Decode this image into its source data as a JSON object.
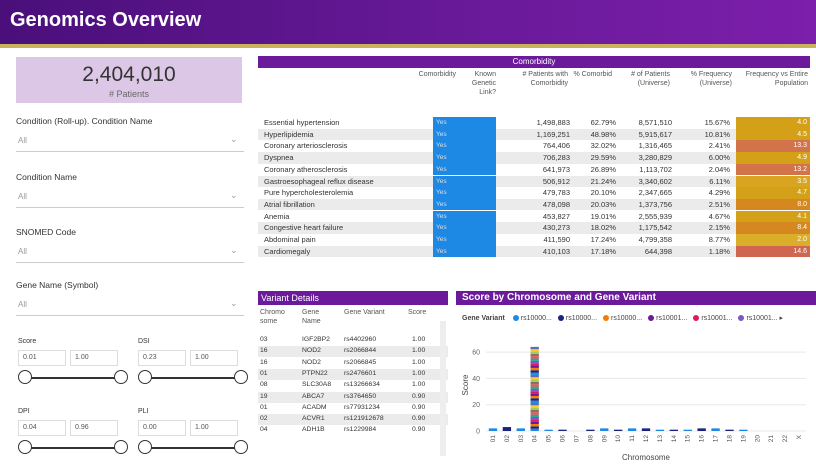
{
  "header": {
    "title": "Genomics Overview"
  },
  "kpi": {
    "value": "2,404,010",
    "label": "# Patients"
  },
  "slicers": [
    {
      "title": "Condition (Roll-up). Condition Name",
      "value": "All"
    },
    {
      "title": "Condition Name",
      "value": "All"
    },
    {
      "title": "SNOMED Code",
      "value": "All"
    },
    {
      "title": "Gene Name (Symbol)",
      "value": "All"
    }
  ],
  "ranges": [
    {
      "title": "Score",
      "min": "0.01",
      "max": "1.00"
    },
    {
      "title": "DSI",
      "min": "0.23",
      "max": "1.00"
    },
    {
      "title": "DPI",
      "min": "0.04",
      "max": "0.96"
    },
    {
      "title": "PLI",
      "min": "0.00",
      "max": "1.00"
    }
  ],
  "comorbidity": {
    "title": "Comorbidity",
    "headers": [
      "Comorbidity",
      "Known Genetic Link?",
      "# Patients with Comorbidity",
      "% Comorbid",
      "# of Patients (Universe)",
      "% Frequency (Universe)",
      "Frequency vs Entire Population"
    ],
    "rows": [
      {
        "name": "Essential hypertension",
        "known": "Yes",
        "patients": "1,498,883",
        "pct": "62.79%",
        "universe": "8,571,510",
        "freq": "15.67%",
        "vs": "4.0",
        "color": "#d4a017"
      },
      {
        "name": "Hyperlipidemia",
        "known": "Yes",
        "patients": "1,169,251",
        "pct": "48.98%",
        "universe": "5,915,617",
        "freq": "10.81%",
        "vs": "4.5",
        "color": "#d4a017"
      },
      {
        "name": "Coronary arteriosclerosis",
        "known": "Yes",
        "patients": "764,406",
        "pct": "32.02%",
        "universe": "1,316,465",
        "freq": "2.41%",
        "vs": "13.3",
        "color": "#d2734a"
      },
      {
        "name": "Dyspnea",
        "known": "Yes",
        "patients": "706,283",
        "pct": "29.59%",
        "universe": "3,280,829",
        "freq": "6.00%",
        "vs": "4.9",
        "color": "#d4a017"
      },
      {
        "name": "Coronary atherosclerosis",
        "known": "Yes",
        "patients": "641,973",
        "pct": "26.89%",
        "universe": "1,113,702",
        "freq": "2.04%",
        "vs": "13.2",
        "color": "#d2734a"
      },
      {
        "name": "Gastroesophageal reflux disease",
        "known": "Yes",
        "patients": "506,912",
        "pct": "21.24%",
        "universe": "3,340,602",
        "freq": "6.11%",
        "vs": "3.5",
        "color": "#d9a521"
      },
      {
        "name": "Pure hypercholesterolemia",
        "known": "Yes",
        "patients": "479,783",
        "pct": "20.10%",
        "universe": "2,347,665",
        "freq": "4.29%",
        "vs": "4.7",
        "color": "#d4a017"
      },
      {
        "name": "Atrial fibrillation",
        "known": "Yes",
        "patients": "478,098",
        "pct": "20.03%",
        "universe": "1,373,756",
        "freq": "2.51%",
        "vs": "8.0",
        "color": "#d4881f"
      },
      {
        "name": "Anemia",
        "known": "Yes",
        "patients": "453,827",
        "pct": "19.01%",
        "universe": "2,555,939",
        "freq": "4.67%",
        "vs": "4.1",
        "color": "#d4a017"
      },
      {
        "name": "Congestive heart failure",
        "known": "Yes",
        "patients": "430,273",
        "pct": "18.02%",
        "universe": "1,175,542",
        "freq": "2.15%",
        "vs": "8.4",
        "color": "#d4881f"
      },
      {
        "name": "Abdominal pain",
        "known": "Yes",
        "patients": "411,590",
        "pct": "17.24%",
        "universe": "4,799,358",
        "freq": "8.77%",
        "vs": "2.0",
        "color": "#dbae2a"
      },
      {
        "name": "Cardiomegaly",
        "known": "Yes",
        "patients": "410,103",
        "pct": "17.18%",
        "universe": "644,398",
        "freq": "1.18%",
        "vs": "14.6",
        "color": "#d0664f"
      }
    ]
  },
  "variant": {
    "title": "Variant Details",
    "headers": [
      "Chromo some",
      "Gene Name",
      "Gene Variant",
      "Score"
    ],
    "rows": [
      {
        "chr": "03",
        "gene": "IGF2BP2",
        "variant": "rs4402960",
        "score": "1.00"
      },
      {
        "chr": "16",
        "gene": "NOD2",
        "variant": "rs2066844",
        "score": "1.00"
      },
      {
        "chr": "16",
        "gene": "NOD2",
        "variant": "rs2066845",
        "score": "1.00"
      },
      {
        "chr": "01",
        "gene": "PTPN22",
        "variant": "rs2476601",
        "score": "1.00"
      },
      {
        "chr": "08",
        "gene": "SLC30A8",
        "variant": "rs13266634",
        "score": "1.00"
      },
      {
        "chr": "19",
        "gene": "ABCA7",
        "variant": "rs3764650",
        "score": "0.90"
      },
      {
        "chr": "01",
        "gene": "ACADM",
        "variant": "rs77931234",
        "score": "0.90"
      },
      {
        "chr": "02",
        "gene": "ACVR1",
        "variant": "rs121912678",
        "score": "0.90"
      },
      {
        "chr": "04",
        "gene": "ADH1B",
        "variant": "rs1229984",
        "score": "0.90"
      }
    ]
  },
  "score_chart": {
    "title": "Score by Chromosome and Gene Variant",
    "legend_label": "Gene Variant",
    "legend": [
      {
        "name": "rs10000...",
        "color": "#1e88e5"
      },
      {
        "name": "rs10000...",
        "color": "#1a237e"
      },
      {
        "name": "rs10000...",
        "color": "#f57c00"
      },
      {
        "name": "rs10001...",
        "color": "#6a1a9a"
      },
      {
        "name": "rs10001...",
        "color": "#d81b60"
      },
      {
        "name": "rs10001...",
        "color": "#7e57c2"
      }
    ],
    "more_icon": "chevron-right-icon",
    "ylabel": "Score",
    "xlabel": "Chromosome"
  },
  "chart_data": {
    "type": "bar",
    "categories": [
      "01",
      "02",
      "03",
      "04",
      "05",
      "06",
      "07",
      "08",
      "09",
      "10",
      "11",
      "12",
      "13",
      "14",
      "15",
      "16",
      "17",
      "18",
      "19",
      "20",
      "21",
      "22",
      "X"
    ],
    "values": [
      2,
      3,
      2,
      64,
      1,
      1,
      0,
      1,
      2,
      1,
      2,
      2,
      1,
      1,
      1,
      2,
      2,
      1,
      1,
      0,
      0,
      0,
      0
    ],
    "ylim": [
      0,
      70
    ],
    "yticks": [
      0,
      20,
      40,
      60
    ],
    "xlabel": "Chromosome",
    "ylabel": "Score",
    "stack_colors": [
      "#1e88e5",
      "#1a237e",
      "#f57c00",
      "#6a1a9a",
      "#d81b60",
      "#7e57c2",
      "#26a69a",
      "#ef5350",
      "#8d6e63",
      "#9ccc65",
      "#ffca28",
      "#5c6bc0"
    ]
  }
}
